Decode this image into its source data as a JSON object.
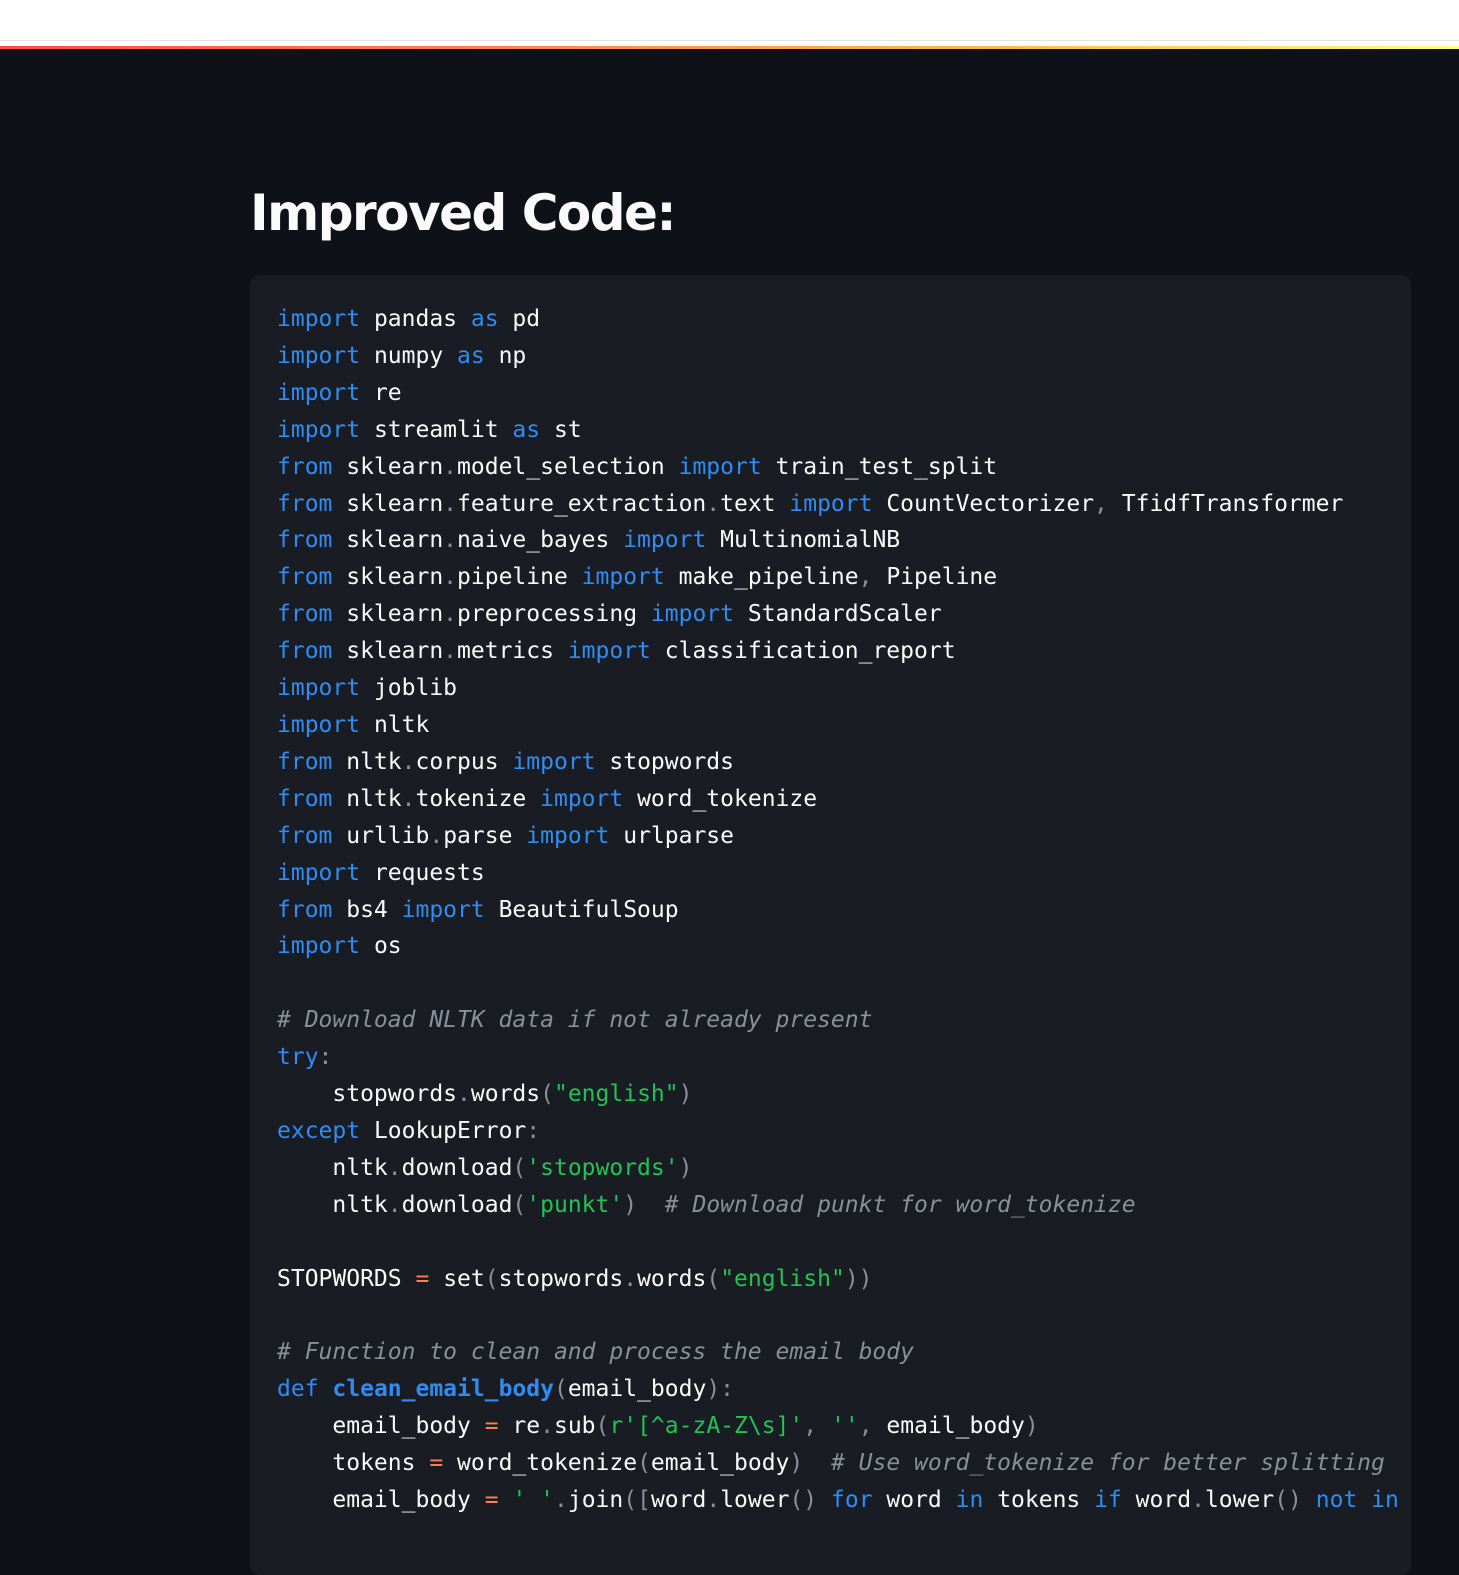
{
  "header": {
    "background": "#ffffff",
    "stripe_colors": [
      "#ff4b4b",
      "#ffbd45",
      "#fffd80"
    ]
  },
  "main": {
    "title": "Improved Code:"
  },
  "colors": {
    "background": "#0e1117",
    "code_background": "#1a1c24",
    "keyword": "#2f8cf2",
    "string": "#21c354",
    "comment": "#8a8f99",
    "operator": "#ff7f4f",
    "text": "#fafafa"
  },
  "code": {
    "language": "python",
    "lines": [
      [
        [
          "kw",
          "import"
        ],
        [
          "t",
          " pandas "
        ],
        [
          "kw",
          "as"
        ],
        [
          "t",
          " pd"
        ]
      ],
      [
        [
          "kw",
          "import"
        ],
        [
          "t",
          " numpy "
        ],
        [
          "kw",
          "as"
        ],
        [
          "t",
          " np"
        ]
      ],
      [
        [
          "kw",
          "import"
        ],
        [
          "t",
          " re"
        ]
      ],
      [
        [
          "kw",
          "import"
        ],
        [
          "t",
          " streamlit "
        ],
        [
          "kw",
          "as"
        ],
        [
          "t",
          " st"
        ]
      ],
      [
        [
          "kw",
          "from"
        ],
        [
          "t",
          " sklearn"
        ],
        [
          "p",
          "."
        ],
        [
          "t",
          "model_selection "
        ],
        [
          "kw",
          "import"
        ],
        [
          "t",
          " train_test_split"
        ]
      ],
      [
        [
          "kw",
          "from"
        ],
        [
          "t",
          " sklearn"
        ],
        [
          "p",
          "."
        ],
        [
          "t",
          "feature_extraction"
        ],
        [
          "p",
          "."
        ],
        [
          "t",
          "text "
        ],
        [
          "kw",
          "import"
        ],
        [
          "t",
          " CountVectorizer"
        ],
        [
          "p",
          ","
        ],
        [
          "t",
          " TfidfTransformer"
        ]
      ],
      [
        [
          "kw",
          "from"
        ],
        [
          "t",
          " sklearn"
        ],
        [
          "p",
          "."
        ],
        [
          "t",
          "naive_bayes "
        ],
        [
          "kw",
          "import"
        ],
        [
          "t",
          " MultinomialNB"
        ]
      ],
      [
        [
          "kw",
          "from"
        ],
        [
          "t",
          " sklearn"
        ],
        [
          "p",
          "."
        ],
        [
          "t",
          "pipeline "
        ],
        [
          "kw",
          "import"
        ],
        [
          "t",
          " make_pipeline"
        ],
        [
          "p",
          ","
        ],
        [
          "t",
          " Pipeline"
        ]
      ],
      [
        [
          "kw",
          "from"
        ],
        [
          "t",
          " sklearn"
        ],
        [
          "p",
          "."
        ],
        [
          "t",
          "preprocessing "
        ],
        [
          "kw",
          "import"
        ],
        [
          "t",
          " StandardScaler"
        ]
      ],
      [
        [
          "kw",
          "from"
        ],
        [
          "t",
          " sklearn"
        ],
        [
          "p",
          "."
        ],
        [
          "t",
          "metrics "
        ],
        [
          "kw",
          "import"
        ],
        [
          "t",
          " classification_report"
        ]
      ],
      [
        [
          "kw",
          "import"
        ],
        [
          "t",
          " joblib"
        ]
      ],
      [
        [
          "kw",
          "import"
        ],
        [
          "t",
          " nltk"
        ]
      ],
      [
        [
          "kw",
          "from"
        ],
        [
          "t",
          " nltk"
        ],
        [
          "p",
          "."
        ],
        [
          "t",
          "corpus "
        ],
        [
          "kw",
          "import"
        ],
        [
          "t",
          " stopwords"
        ]
      ],
      [
        [
          "kw",
          "from"
        ],
        [
          "t",
          " nltk"
        ],
        [
          "p",
          "."
        ],
        [
          "t",
          "tokenize "
        ],
        [
          "kw",
          "import"
        ],
        [
          "t",
          " word_tokenize"
        ]
      ],
      [
        [
          "kw",
          "from"
        ],
        [
          "t",
          " urllib"
        ],
        [
          "p",
          "."
        ],
        [
          "t",
          "parse "
        ],
        [
          "kw",
          "import"
        ],
        [
          "t",
          " urlparse"
        ]
      ],
      [
        [
          "kw",
          "import"
        ],
        [
          "t",
          " requests"
        ]
      ],
      [
        [
          "kw",
          "from"
        ],
        [
          "t",
          " bs4 "
        ],
        [
          "kw",
          "import"
        ],
        [
          "t",
          " BeautifulSoup"
        ]
      ],
      [
        [
          "kw",
          "import"
        ],
        [
          "t",
          " os"
        ]
      ],
      [],
      [
        [
          "cm",
          "# Download NLTK data if not already present"
        ]
      ],
      [
        [
          "kw",
          "try"
        ],
        [
          "p",
          ":"
        ]
      ],
      [
        [
          "t",
          "    stopwords"
        ],
        [
          "p",
          "."
        ],
        [
          "t",
          "words"
        ],
        [
          "p",
          "("
        ],
        [
          "str",
          "\"english\""
        ],
        [
          "p",
          ")"
        ]
      ],
      [
        [
          "kw",
          "except"
        ],
        [
          "t",
          " LookupError"
        ],
        [
          "p",
          ":"
        ]
      ],
      [
        [
          "t",
          "    nltk"
        ],
        [
          "p",
          "."
        ],
        [
          "t",
          "download"
        ],
        [
          "p",
          "("
        ],
        [
          "str",
          "'stopwords'"
        ],
        [
          "p",
          ")"
        ]
      ],
      [
        [
          "t",
          "    nltk"
        ],
        [
          "p",
          "."
        ],
        [
          "t",
          "download"
        ],
        [
          "p",
          "("
        ],
        [
          "str",
          "'punkt'"
        ],
        [
          "p",
          ")"
        ],
        [
          "t",
          "  "
        ],
        [
          "cm",
          "# Download punkt for word_tokenize"
        ]
      ],
      [],
      [
        [
          "t",
          "STOPWORDS "
        ],
        [
          "op",
          "="
        ],
        [
          "t",
          " set"
        ],
        [
          "p",
          "("
        ],
        [
          "t",
          "stopwords"
        ],
        [
          "p",
          "."
        ],
        [
          "t",
          "words"
        ],
        [
          "p",
          "("
        ],
        [
          "str",
          "\"english\""
        ],
        [
          "p",
          "))"
        ]
      ],
      [],
      [
        [
          "cm",
          "# Function to clean and process the email body"
        ]
      ],
      [
        [
          "kw",
          "def"
        ],
        [
          "t",
          " "
        ],
        [
          "fn",
          "clean_email_body"
        ],
        [
          "p",
          "("
        ],
        [
          "t",
          "email_body"
        ],
        [
          "p",
          "):"
        ]
      ],
      [
        [
          "t",
          "    email_body "
        ],
        [
          "op",
          "="
        ],
        [
          "t",
          " re"
        ],
        [
          "p",
          "."
        ],
        [
          "t",
          "sub"
        ],
        [
          "p",
          "("
        ],
        [
          "str",
          "r'[^a-zA-Z\\s]'"
        ],
        [
          "p",
          ","
        ],
        [
          "t",
          " "
        ],
        [
          "str",
          "''"
        ],
        [
          "p",
          ","
        ],
        [
          "t",
          " email_body"
        ],
        [
          "p",
          ")"
        ]
      ],
      [
        [
          "t",
          "    tokens "
        ],
        [
          "op",
          "="
        ],
        [
          "t",
          " word_tokenize"
        ],
        [
          "p",
          "("
        ],
        [
          "t",
          "email_body"
        ],
        [
          "p",
          ")"
        ],
        [
          "t",
          "  "
        ],
        [
          "cm",
          "# Use word_tokenize for better splitting"
        ]
      ],
      [
        [
          "t",
          "    email_body "
        ],
        [
          "op",
          "="
        ],
        [
          "t",
          " "
        ],
        [
          "str",
          "' '"
        ],
        [
          "p",
          "."
        ],
        [
          "t",
          "join"
        ],
        [
          "p",
          "(["
        ],
        [
          "t",
          "word"
        ],
        [
          "p",
          "."
        ],
        [
          "t",
          "lower"
        ],
        [
          "p",
          "()"
        ],
        [
          "t",
          " "
        ],
        [
          "kw",
          "for"
        ],
        [
          "t",
          " word "
        ],
        [
          "kw",
          "in"
        ],
        [
          "t",
          " tokens "
        ],
        [
          "kw",
          "if"
        ],
        [
          "t",
          " word"
        ],
        [
          "p",
          "."
        ],
        [
          "t",
          "lower"
        ],
        [
          "p",
          "()"
        ],
        [
          "t",
          " "
        ],
        [
          "kw",
          "not"
        ],
        [
          "t",
          " "
        ],
        [
          "kw",
          "in"
        ]
      ]
    ]
  }
}
